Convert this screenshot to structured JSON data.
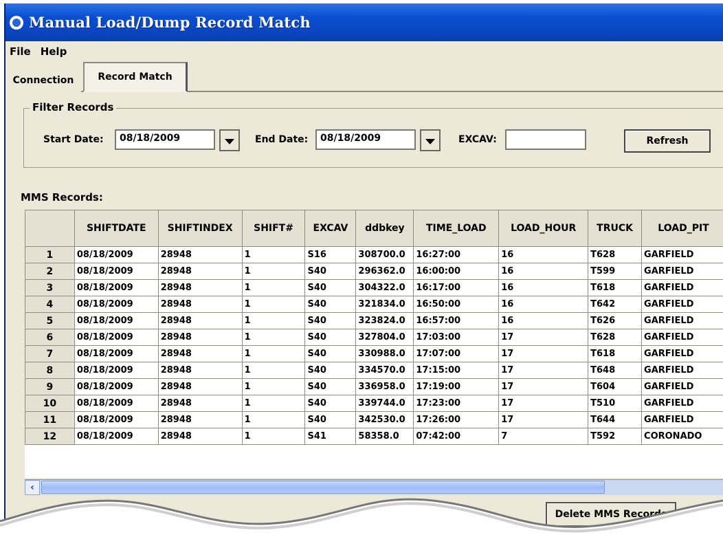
{
  "window": {
    "title": "Manual Load/Dump Record Match"
  },
  "menu": [
    {
      "label": "File"
    },
    {
      "label": "Help"
    }
  ],
  "tabs": [
    {
      "label": "Connection",
      "active": false
    },
    {
      "label": "Record Match",
      "active": true
    }
  ],
  "filter": {
    "group_title": "Filter Records",
    "start_label": "Start Date:",
    "start_value": "08/18/2009",
    "end_label": "End Date:",
    "end_value": "08/18/2009",
    "excav_label": "EXCAV:",
    "excav_value": "",
    "refresh_label": "Refresh"
  },
  "records": {
    "label": "MMS Records:",
    "columns": [
      "",
      "SHIFTDATE",
      "SHIFTINDEX",
      "SHIFT#",
      "EXCAV",
      "ddbkey",
      "TIME_LOAD",
      "LOAD_HOUR",
      "TRUCK",
      "LOAD_PIT"
    ],
    "rows": [
      [
        "1",
        "08/18/2009",
        "28948",
        "1",
        "S16",
        "308700.0",
        "16:27:00",
        "16",
        "T628",
        "GARFIELD"
      ],
      [
        "2",
        "08/18/2009",
        "28948",
        "1",
        "S40",
        "296362.0",
        "16:00:00",
        "16",
        "T599",
        "GARFIELD"
      ],
      [
        "3",
        "08/18/2009",
        "28948",
        "1",
        "S40",
        "304322.0",
        "16:17:00",
        "16",
        "T618",
        "GARFIELD"
      ],
      [
        "4",
        "08/18/2009",
        "28948",
        "1",
        "S40",
        "321834.0",
        "16:50:00",
        "16",
        "T642",
        "GARFIELD"
      ],
      [
        "5",
        "08/18/2009",
        "28948",
        "1",
        "S40",
        "323824.0",
        "16:57:00",
        "16",
        "T626",
        "GARFIELD"
      ],
      [
        "6",
        "08/18/2009",
        "28948",
        "1",
        "S40",
        "327804.0",
        "17:03:00",
        "17",
        "T628",
        "GARFIELD"
      ],
      [
        "7",
        "08/18/2009",
        "28948",
        "1",
        "S40",
        "330988.0",
        "17:07:00",
        "17",
        "T618",
        "GARFIELD"
      ],
      [
        "8",
        "08/18/2009",
        "28948",
        "1",
        "S40",
        "334570.0",
        "17:15:00",
        "17",
        "T648",
        "GARFIELD"
      ],
      [
        "9",
        "08/18/2009",
        "28948",
        "1",
        "S40",
        "336958.0",
        "17:19:00",
        "17",
        "T604",
        "GARFIELD"
      ],
      [
        "10",
        "08/18/2009",
        "28948",
        "1",
        "S40",
        "339744.0",
        "17:23:00",
        "17",
        "T510",
        "GARFIELD"
      ],
      [
        "11",
        "08/18/2009",
        "28948",
        "1",
        "S40",
        "342530.0",
        "17:26:00",
        "17",
        "T644",
        "GARFIELD"
      ],
      [
        "12",
        "08/18/2009",
        "28948",
        "1",
        "S41",
        "58358.0",
        "07:42:00",
        "7",
        "T592",
        "CORONADO"
      ]
    ]
  },
  "delete_label": "Delete MMS Records",
  "icons": {
    "app": "app-logo-icon",
    "dropdown": "chevron-down-icon",
    "scroll_left": "arrow-left-icon"
  },
  "colors": {
    "titlebar": "#0b46c2",
    "face": "#ece9d8",
    "scrollbar": "#9fbcf6"
  }
}
